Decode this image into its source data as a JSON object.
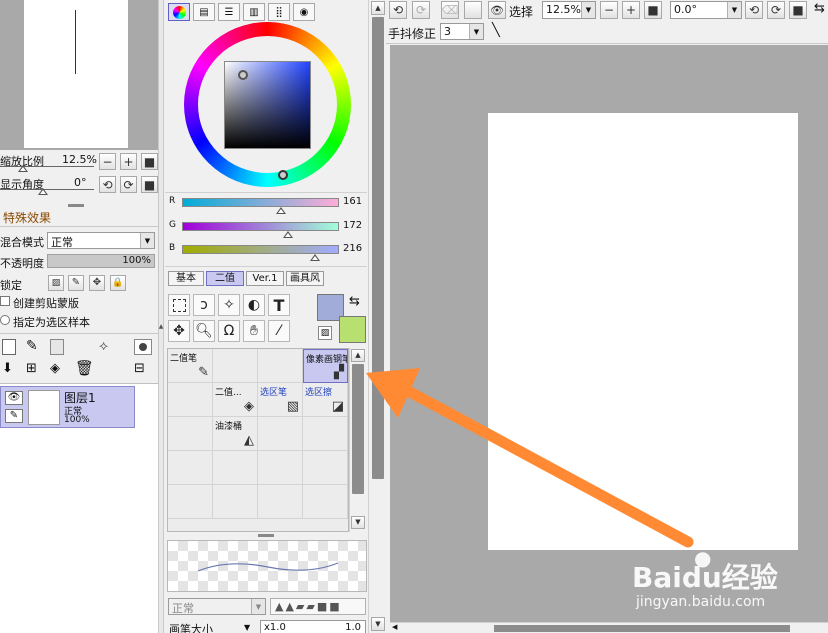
{
  "navigator": {
    "zoom_label": "缩放比例",
    "zoom_value": "12.5%",
    "rotation_label": "显示角度",
    "rotation_value": "0°"
  },
  "layer_panel": {
    "effects_label": "特殊效果",
    "blend_mode_label": "混合模式",
    "blend_mode_value": "正常",
    "opacity_label": "不透明度",
    "opacity_value": "100%",
    "opacity_fraction": 1.0,
    "protect_label": "锁定",
    "clipping_label": "创建剪贴蒙版",
    "selection_source_label": "指定为选区样本",
    "layers": [
      {
        "name": "图层1",
        "mode": "正常",
        "opacity": "100%"
      }
    ]
  },
  "color_panel": {
    "r_label": "R",
    "r_value": "161",
    "r": 161,
    "g_label": "G",
    "g_value": "172",
    "g": 172,
    "b_label": "B",
    "b_value": "216",
    "b": 216,
    "primary_color": "#a1acd8",
    "secondary_color": "#b8e070"
  },
  "brush_tabs": [
    {
      "label": "基本",
      "active": false
    },
    {
      "label": "二值",
      "active": true
    },
    {
      "label": "Ver.1",
      "active": false
    },
    {
      "label": "画具风",
      "active": false
    }
  ],
  "tool_presets": [
    {
      "name": "二值笔",
      "icon": "pen-icon",
      "glyph": "✎",
      "selected": false
    },
    {
      "name": "",
      "icon": "",
      "glyph": "",
      "selected": false
    },
    {
      "name": "",
      "icon": "",
      "glyph": "",
      "selected": false
    },
    {
      "name": "像素画钢笔",
      "icon": "pixel-pen-icon",
      "glyph": "▞",
      "selected": true
    },
    {
      "name": "",
      "icon": "",
      "glyph": "",
      "selected": false
    },
    {
      "name": "二值...",
      "icon": "eraser-icon",
      "glyph": "◈",
      "selected": false
    },
    {
      "name": "选区笔",
      "icon": "selection-pen-icon",
      "glyph": "▧",
      "selected": false
    },
    {
      "name": "选区擦",
      "icon": "selection-eraser-icon",
      "glyph": "◪",
      "selected": false
    },
    {
      "name": "",
      "icon": "",
      "glyph": "",
      "selected": false
    },
    {
      "name": "油漆桶",
      "icon": "bucket-icon",
      "glyph": "◭",
      "selected": false
    }
  ],
  "brush_settings": {
    "mode_value": "正常",
    "size_label": "画笔大小",
    "size_multiplier": "x1.0",
    "size_value": "1.0"
  },
  "canvas_toolbar": {
    "select_label": "选择",
    "zoom_value": "12.5%",
    "angle_value": "0.0°",
    "stabilizer_label": "手抖修正",
    "stabilizer_value": "3"
  },
  "watermark": {
    "logo_text": "Baidu经验",
    "url": "jingyan.baidu.com"
  },
  "colors": {
    "panel_bg": "#f0f0f0",
    "canvas_bg": "#a9a9a9",
    "selected_bg": "#c8c8f0",
    "arrow": "#ff8a33"
  }
}
